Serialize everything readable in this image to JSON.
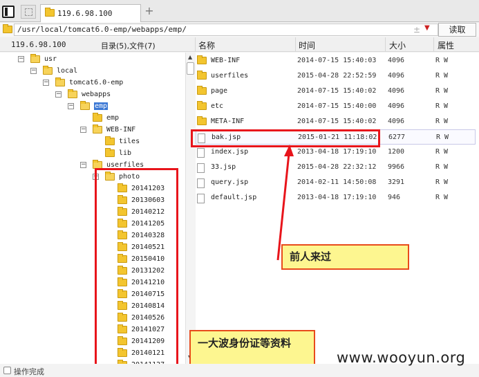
{
  "tab": {
    "title": "119.6.98.100",
    "add_label": "+"
  },
  "address": {
    "path": "/usr/local/tomcat6.0-emp/webapps/emp/",
    "plusminus": "±",
    "read_button": "读取"
  },
  "tree_header": {
    "ip": "119.6.98.100",
    "summary": "目录(5),文件(7)"
  },
  "columns": {
    "name": "名称",
    "time": "时间",
    "size": "大小",
    "attr": "属性"
  },
  "tree": [
    {
      "label": "usr",
      "toggle": "−"
    },
    {
      "label": "local",
      "toggle": "−"
    },
    {
      "label": "tomcat6.0-emp",
      "toggle": "−"
    },
    {
      "label": "webapps",
      "toggle": "−"
    },
    {
      "label": "emp",
      "toggle": "−",
      "selected": true
    },
    {
      "label": "emp",
      "toggle": ""
    },
    {
      "label": "WEB-INF",
      "toggle": "−"
    },
    {
      "label": "tiles",
      "toggle": ""
    },
    {
      "label": "lib",
      "toggle": ""
    },
    {
      "label": "userfiles",
      "toggle": "−"
    },
    {
      "label": "photo",
      "toggle": "−"
    },
    {
      "label": "20141203",
      "toggle": ""
    },
    {
      "label": "20130603",
      "toggle": ""
    },
    {
      "label": "20140212",
      "toggle": ""
    },
    {
      "label": "20141205",
      "toggle": ""
    },
    {
      "label": "20140328",
      "toggle": ""
    },
    {
      "label": "20140521",
      "toggle": ""
    },
    {
      "label": "20150410",
      "toggle": ""
    },
    {
      "label": "20131202",
      "toggle": ""
    },
    {
      "label": "20141210",
      "toggle": ""
    },
    {
      "label": "20140715",
      "toggle": ""
    },
    {
      "label": "20140814",
      "toggle": ""
    },
    {
      "label": "20140526",
      "toggle": ""
    },
    {
      "label": "20141027",
      "toggle": ""
    },
    {
      "label": "20141209",
      "toggle": ""
    },
    {
      "label": "20140121",
      "toggle": ""
    },
    {
      "label": "20141127",
      "toggle": ""
    }
  ],
  "files": [
    {
      "name": "WEB-INF",
      "time": "2014-07-15 15:40:03",
      "size": "4096",
      "attr": "R W",
      "type": "folder"
    },
    {
      "name": "userfiles",
      "time": "2015-04-28 22:52:59",
      "size": "4096",
      "attr": "R W",
      "type": "folder"
    },
    {
      "name": "page",
      "time": "2014-07-15 15:40:02",
      "size": "4096",
      "attr": "R W",
      "type": "folder"
    },
    {
      "name": "etc",
      "time": "2014-07-15 15:40:00",
      "size": "4096",
      "attr": "R W",
      "type": "folder"
    },
    {
      "name": "META-INF",
      "time": "2014-07-15 15:40:02",
      "size": "4096",
      "attr": "R W",
      "type": "folder"
    },
    {
      "name": "bak.jsp",
      "time": "2015-01-21 11:18:02",
      "size": "6277",
      "attr": "R W",
      "type": "file"
    },
    {
      "name": "index.jsp",
      "time": "2013-04-18 17:19:10",
      "size": "1200",
      "attr": "R W",
      "type": "file"
    },
    {
      "name": "33.jsp",
      "time": "2015-04-28 22:32:12",
      "size": "9966",
      "attr": "R W",
      "type": "file"
    },
    {
      "name": "query.jsp",
      "time": "2014-02-11 14:50:08",
      "size": "3291",
      "attr": "R W",
      "type": "file"
    },
    {
      "name": "default.jsp",
      "time": "2013-04-18 17:19:10",
      "size": "946",
      "attr": "R W",
      "type": "file"
    }
  ],
  "annotations": {
    "callout_1": "前人来过",
    "callout_2": "一大波身份证等资料"
  },
  "status": {
    "text": "操作完成"
  },
  "watermark": "www.wooyun.org",
  "colors": {
    "highlight_box": "#e8141b",
    "callout_bg": "#fdf690",
    "selection": "#3a77d4",
    "folder": "#f3c52f"
  }
}
